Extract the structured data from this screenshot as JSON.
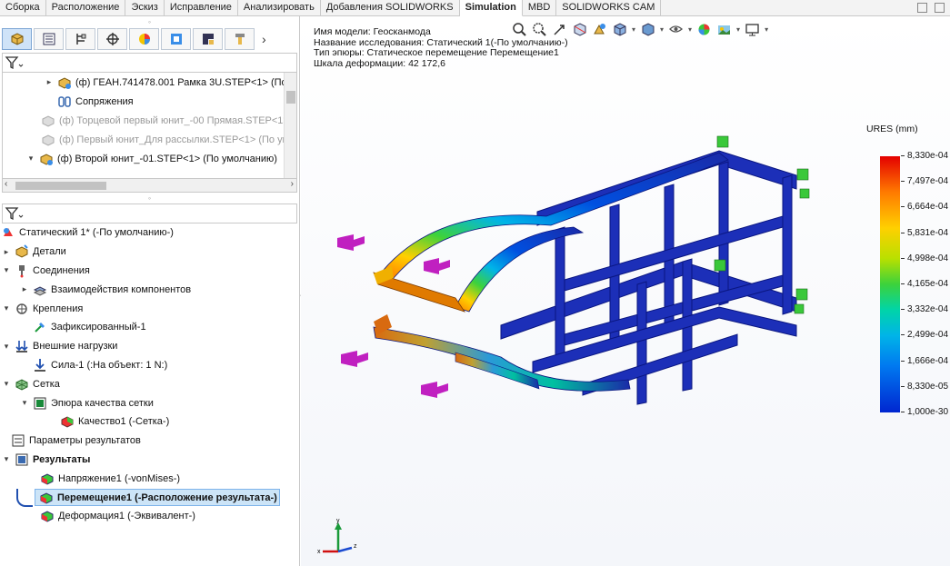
{
  "tabs": [
    "Сборка",
    "Расположение",
    "Эскиз",
    "Исправление",
    "Анализировать",
    "Добавления SOLIDWORKS",
    "Simulation",
    "MBD",
    "SOLIDWORKS CAM"
  ],
  "active_tab": "Simulation",
  "feature_tree": {
    "items": [
      {
        "label": "(ф) ГЕАН.741478.001 Рамка 3U.STEP<1> (По у",
        "dim": false
      },
      {
        "label": "Сопряжения",
        "dim": false
      },
      {
        "label": "(ф) Торцевой первый юнит_-00 Прямая.STEP<1>",
        "dim": true
      },
      {
        "label": "(ф) Первый юнит_Для рассылки.STEP<1> (По ум",
        "dim": true
      },
      {
        "label": "(ф) Второй юнит_-01.STEP<1> (По умолчанию)",
        "dim": false
      }
    ]
  },
  "study_tree": {
    "root": "Статический 1* (-По умолчанию-)",
    "items": [
      {
        "label": "Детали"
      },
      {
        "label": "Соединения"
      },
      {
        "label": "Взаимодействия компонентов"
      },
      {
        "label": "Крепления"
      },
      {
        "label": "Зафиксированный-1"
      },
      {
        "label": "Внешние нагрузки"
      },
      {
        "label": "Сила-1 (:На объект: 1 N:)"
      },
      {
        "label": "Сетка"
      },
      {
        "label": "Эпюра качества сетки"
      },
      {
        "label": "Качество1 (-Сетка-)"
      },
      {
        "label": "Параметры результатов"
      },
      {
        "label": "Результаты"
      },
      {
        "label": "Напряжение1 (-vonMises-)"
      },
      {
        "label": "Перемещение1 (-Расположение результата-)"
      },
      {
        "label": "Деформация1 (-Эквивалент-)"
      }
    ]
  },
  "viewport": {
    "info": [
      "Имя модели: Геосканмода",
      "Название исследования: Статический 1(-По умолчанию-)",
      "Тип эпюры: Статическое перемещение Перемещение1",
      "Шкала деформации: 42 172,6"
    ],
    "legend_title": "URES (mm)",
    "legend_values": [
      "8,330e-04",
      "7,497e-04",
      "6,664e-04",
      "5,831e-04",
      "4,998e-04",
      "4,165e-04",
      "3,332e-04",
      "2,499e-04",
      "1,666e-04",
      "8,330e-05",
      "1,000e-30"
    ],
    "triad": {
      "x": "x",
      "y": "y",
      "z": "z"
    }
  }
}
